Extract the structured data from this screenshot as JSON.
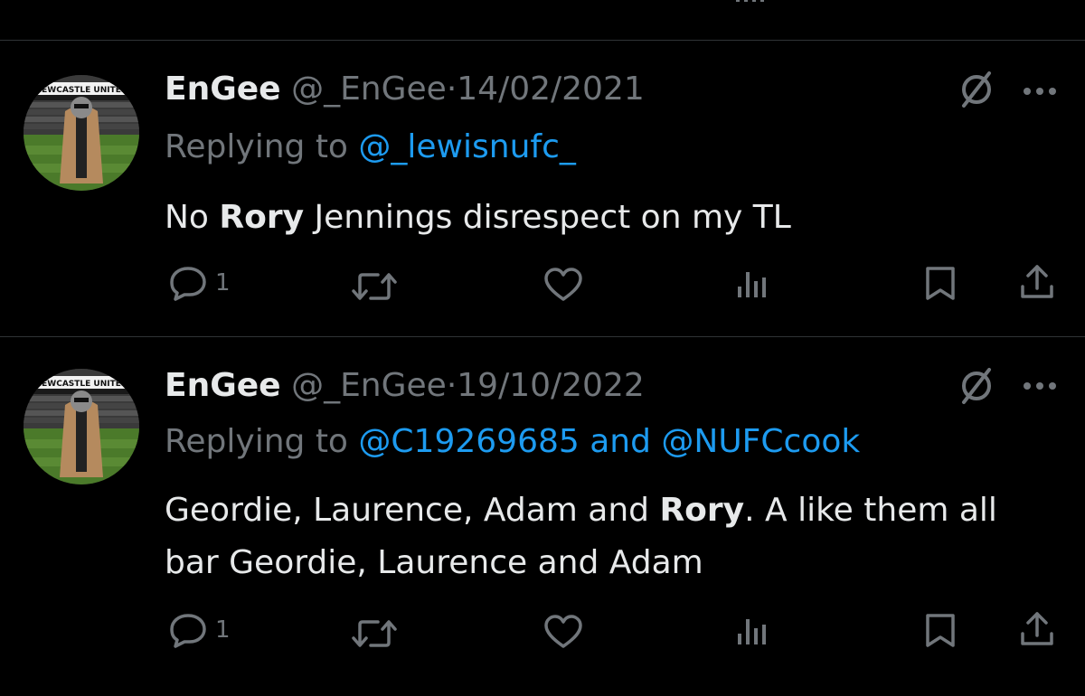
{
  "tweets": [
    {
      "name": "EnGee",
      "handle": "@_EnGee",
      "dot": "·",
      "date": "14/02/2021",
      "replying_prefix": "Replying to ",
      "mention1": "@_lewisnufc_",
      "mention_sep": "",
      "mention2": "",
      "body_before": "No ",
      "body_bold": "Rory",
      "body_after": " Jennings disrespect on my TL",
      "reply_count": "1",
      "avatar_label": "NEWCASTLE UNITED"
    },
    {
      "name": "EnGee",
      "handle": "@_EnGee",
      "dot": "·",
      "date": "19/10/2022",
      "replying_prefix": "Replying to ",
      "mention1": "@C19269685",
      "mention_sep": " and ",
      "mention2": "@NUFCcook",
      "body_before": "Geordie, Laurence, Adam and ",
      "body_bold": "Rory",
      "body_after": ". A like them all bar Geordie, Laurence and Adam",
      "reply_count": "1",
      "avatar_label": "NEWCASTLE UNITED"
    }
  ],
  "icons": {
    "reply": "reply-icon",
    "retweet": "retweet-icon",
    "like": "heart-icon",
    "views": "views-icon",
    "bookmark": "bookmark-icon",
    "share": "share-icon",
    "grok": "grok-icon",
    "more": "more-icon"
  },
  "colors": {
    "background": "#000000",
    "text": "#e7e9ea",
    "muted": "#71767b",
    "link": "#1d9bf0",
    "divider": "#2f3336"
  }
}
